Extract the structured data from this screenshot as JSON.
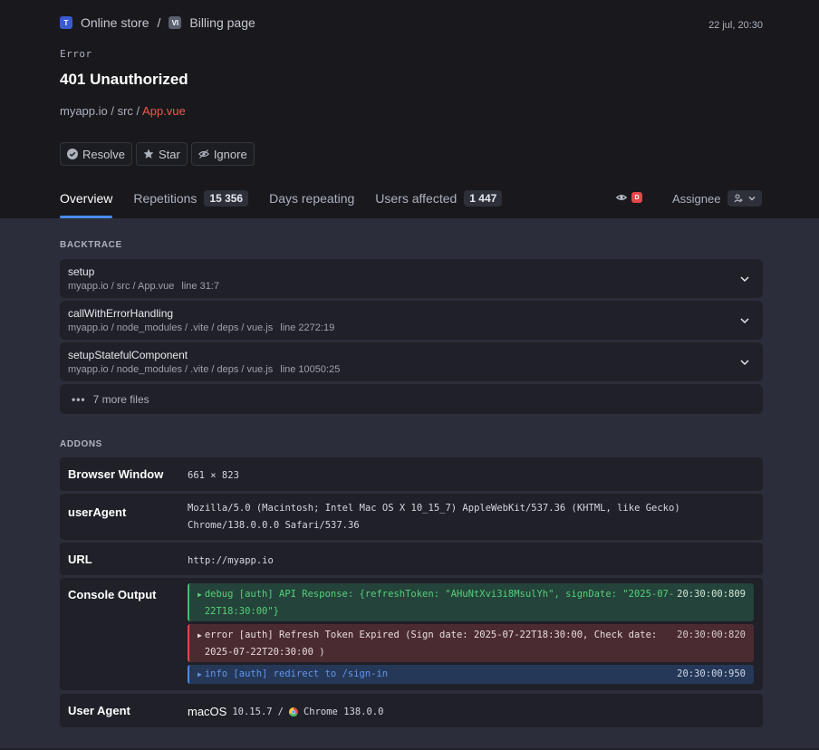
{
  "breadcrumb": {
    "project_badge": "T",
    "project": "Online store",
    "separator": "/",
    "page_badge": "VI",
    "page": "Billing page"
  },
  "timestamp": "22 jul, 20:30",
  "error": {
    "label": "Error",
    "title": "401 Unauthorized",
    "path_prefix": "myapp.io / src / ",
    "path_file": "App.vue"
  },
  "actions": {
    "resolve": "Resolve",
    "star": "Star",
    "ignore": "Ignore"
  },
  "tabs": {
    "overview": "Overview",
    "repetitions": "Repetitions",
    "repetitions_count": "15 356",
    "days_repeating": "Days repeating",
    "users_affected": "Users affected",
    "users_affected_count": "1 447"
  },
  "watcher_badge": "D",
  "assignee_label": "Assignee",
  "backtrace": {
    "title": "BACKTRACE",
    "frames": [
      {
        "fn": "setup",
        "loc": "myapp.io / src / App.vue",
        "line": "line 31:7"
      },
      {
        "fn": "callWithErrorHandling",
        "loc": "myapp.io / node_modules / .vite / deps / vue.js",
        "line": "line 2272:19"
      },
      {
        "fn": "setupStatefulComponent",
        "loc": "myapp.io / node_modules / .vite / deps / vue.js",
        "line": "line 10050:25"
      }
    ],
    "more_dots": "•••",
    "more": "7 more files"
  },
  "addons": {
    "title": "ADDONS",
    "browser_window": {
      "key": "Browser Window",
      "value": "661 × 823"
    },
    "user_agent_raw": {
      "key": "userAgent",
      "value": "Mozilla/5.0 (Macintosh; Intel Mac OS X 10_15_7) AppleWebKit/537.36 (KHTML, like Gecko) Chrome/138.0.0.0 Safari/537.36"
    },
    "url": {
      "key": "URL",
      "value": "http://myapp.io"
    },
    "console": {
      "key": "Console Output",
      "logs": [
        {
          "level": "debug",
          "arrow": "▶",
          "text": "debug [auth] API Response: {refreshToken: \"AHuNtXvi3i8MsulYh\", signDate: \"2025-07-22T18:30:00\"}",
          "time": "20:30:00:809"
        },
        {
          "level": "error",
          "arrow": "▶",
          "text": "error [auth] Refresh Token Expired (Sign date: 2025-07-22T18:30:00, Check date: 2025-07-22T20:30:00 )",
          "time": "20:30:00:820"
        },
        {
          "level": "info",
          "arrow": "▶",
          "text": "info [auth] redirect to /sign-in",
          "time": "20:30:00:950"
        }
      ]
    },
    "user_agent": {
      "key": "User Agent",
      "os": "macOS",
      "os_version": "10.15.7",
      "separator": "/",
      "browser": "Chrome 138.0.0"
    }
  },
  "colors": {
    "accent": "#4a8bf0",
    "error_file": "#ef5a4a",
    "debug": "#3fc06a",
    "error": "#e0484a",
    "info": "#4a8bf0"
  }
}
